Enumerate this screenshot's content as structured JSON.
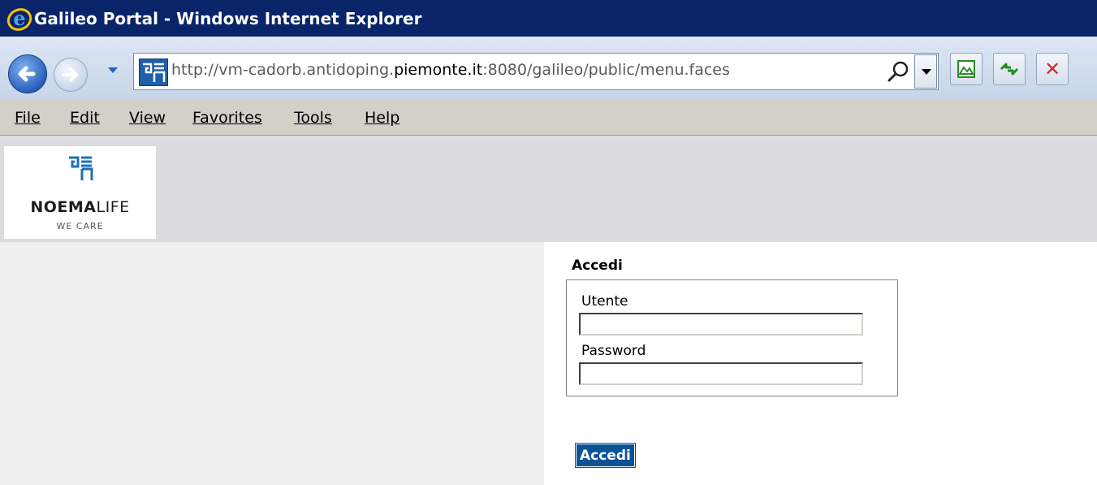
{
  "window": {
    "title": "Galileo Portal - Windows Internet Explorer"
  },
  "address_bar": {
    "url_prefix": "http://vm-cadorb.antidoping.",
    "url_domain": "piemonte.it",
    "url_suffix": ":8080/galileo/public/menu.faces"
  },
  "toolbar": {
    "back_icon": "back-arrow-icon",
    "forward_icon": "forward-arrow-icon",
    "search_icon": "search-icon",
    "compat_icon": "compatibility-view-icon",
    "refresh_icon": "refresh-icon",
    "stop_icon": "stop-icon"
  },
  "menu": {
    "items": [
      {
        "label": "File",
        "accel": "F"
      },
      {
        "label": "Edit",
        "accel": "E"
      },
      {
        "label": "View",
        "accel": "V"
      },
      {
        "label": "Favorites",
        "accel": "a"
      },
      {
        "label": "Tools",
        "accel": "T"
      },
      {
        "label": "Help",
        "accel": "H"
      }
    ]
  },
  "logo": {
    "name_strong": "NOEMA",
    "name_rest": "LIFE",
    "tagline": "WE CARE"
  },
  "login": {
    "title": "Accedi",
    "user_label": "Utente",
    "user_value": "",
    "password_label": "Password",
    "password_value": "",
    "button_label": "Accedi"
  },
  "colors": {
    "titlebar": "#0a246a",
    "header_band": "#dcdbde",
    "left_panel": "#efefef",
    "button": "#0b5394"
  }
}
